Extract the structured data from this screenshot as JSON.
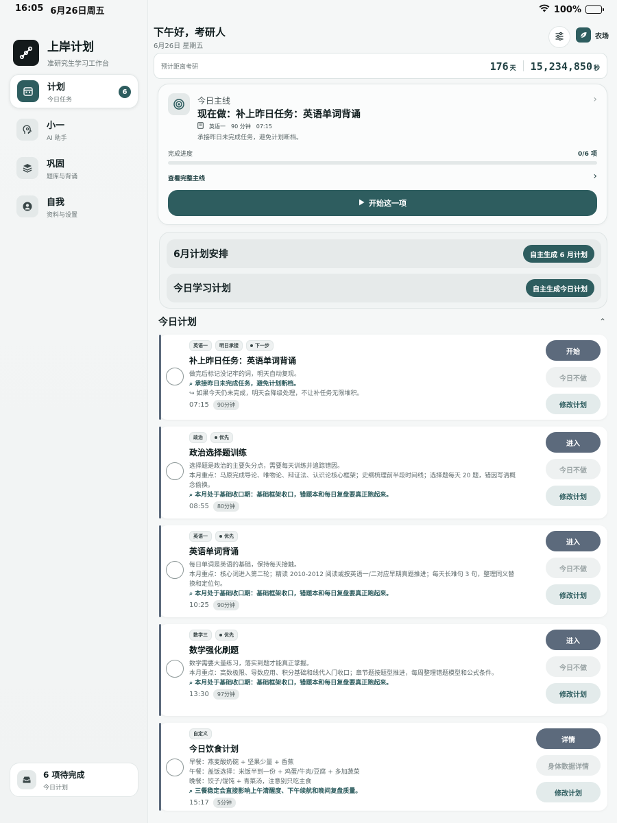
{
  "status": {
    "time": "16:05",
    "date": "6月26日周五",
    "battery": "100%"
  },
  "brand": {
    "title": "上岸计划",
    "subtitle": "准研究生学习工作台"
  },
  "nav": [
    {
      "label": "计划",
      "sub": "今日任务",
      "badge": "6"
    },
    {
      "label": "小一",
      "sub": "AI 助手"
    },
    {
      "label": "巩固",
      "sub": "题库与背诵"
    },
    {
      "label": "自我",
      "sub": "资料与设置"
    }
  ],
  "pending": {
    "title": "6 项待完成",
    "sub": "今日计划"
  },
  "header": {
    "greeting": "下午好，考研人",
    "date": "6月26日 星期五",
    "farm_label": "农场"
  },
  "countdown": {
    "label": "预计距离考研",
    "days": "176",
    "days_unit": "天",
    "seconds": "15,234,850",
    "seconds_unit": "秒"
  },
  "mainline": {
    "heading": "今日主线",
    "title": "现在做：补上昨日任务：英语单词背诵",
    "subject": "英语一",
    "duration": "90 分钟",
    "time": "07:15",
    "desc": "承接昨日未完成任务，避免计划断档。",
    "progress_label": "完成进度",
    "progress_value": "0/6 项",
    "progress_fraction": 0,
    "link": "查看完整主线",
    "start": "开始这一项"
  },
  "schedule": [
    {
      "title": "6月计划安排",
      "button": "自主生成 6 月计划"
    },
    {
      "title": "今日学习计划",
      "button": "自主生成今日计划"
    }
  ],
  "section": {
    "title": "今日计划"
  },
  "tasks": [
    {
      "tags": [
        "英语一",
        "明日承接",
        "下一步"
      ],
      "title": "补上昨日任务：英语单词背诵",
      "lines": [
        "做完后标记没记牢的词，明天自动复现。"
      ],
      "note": "承接昨日未完成任务，避免计划断档。",
      "note2": "如果今天仍未完成，明天会降级处理，不让补任务无限堆积。",
      "time": "07:15",
      "duration": "90分钟",
      "buttons": [
        "开始",
        "今日不做",
        "修改计划"
      ]
    },
    {
      "tags": [
        "政治",
        "优先"
      ],
      "title": "政治选择题训练",
      "lines": [
        "选择题是政治的主要失分点，需要每天训练并追踪错因。",
        "本月重点：马原完成导论、唯物论、辩证法、认识论核心框架；史纲梳理前半段时间线；选择题每天 20 题，错因写清概念偷换。"
      ],
      "note": "本月处于基础收口期：基础框架收口，错题本和每日复盘要真正跑起来。",
      "time": "08:55",
      "duration": "80分钟",
      "buttons": [
        "进入",
        "今日不做",
        "修改计划"
      ]
    },
    {
      "tags": [
        "英语一",
        "优先"
      ],
      "title": "英语单词背诵",
      "lines": [
        "每日单词是英语的基础，保持每天接触。",
        "本月重点：核心词进入第二轮；精读 2010-2012 阅读或按英语一/二对应早期真题推进；每天长难句 3 句，整理同义替换和定位句。"
      ],
      "note": "本月处于基础收口期：基础框架收口，错题本和每日复盘要真正跑起来。",
      "time": "10:25",
      "duration": "90分钟",
      "buttons": [
        "进入",
        "今日不做",
        "修改计划"
      ]
    },
    {
      "tags": [
        "数学三",
        "优先"
      ],
      "title": "数学强化刷题",
      "lines": [
        "数学需要大量练习，落实到题才能真正掌握。",
        "本月重点：高数极限、导数应用、积分基础和线代入门收口；章节题按题型推进，每周整理错题模型和公式条件。"
      ],
      "note": "本月处于基础收口期：基础框架收口，错题本和每日复盘要真正跑起来。",
      "time": "13:30",
      "duration": "97分钟",
      "buttons": [
        "进入",
        "今日不做",
        "修改计划"
      ]
    },
    {
      "tags": [
        "自定义"
      ],
      "title": "今日饮食计划",
      "lines": [
        "早餐：燕麦酸奶碗 + 坚果少量 + 香蕉",
        "午餐：盖饭选择：米饭半到一份 + 鸡蛋/牛肉/豆腐 + 多加蔬菜",
        "晚餐：饺子/馄饨 + 青菜汤，注意别只吃主食"
      ],
      "note": "三餐稳定会直接影响上午清醒度、下午续航和晚间复盘质量。",
      "time": "15:17",
      "duration": "5分钟",
      "buttons": [
        "详情",
        "身体数据详情",
        "修改计划"
      ]
    }
  ]
}
